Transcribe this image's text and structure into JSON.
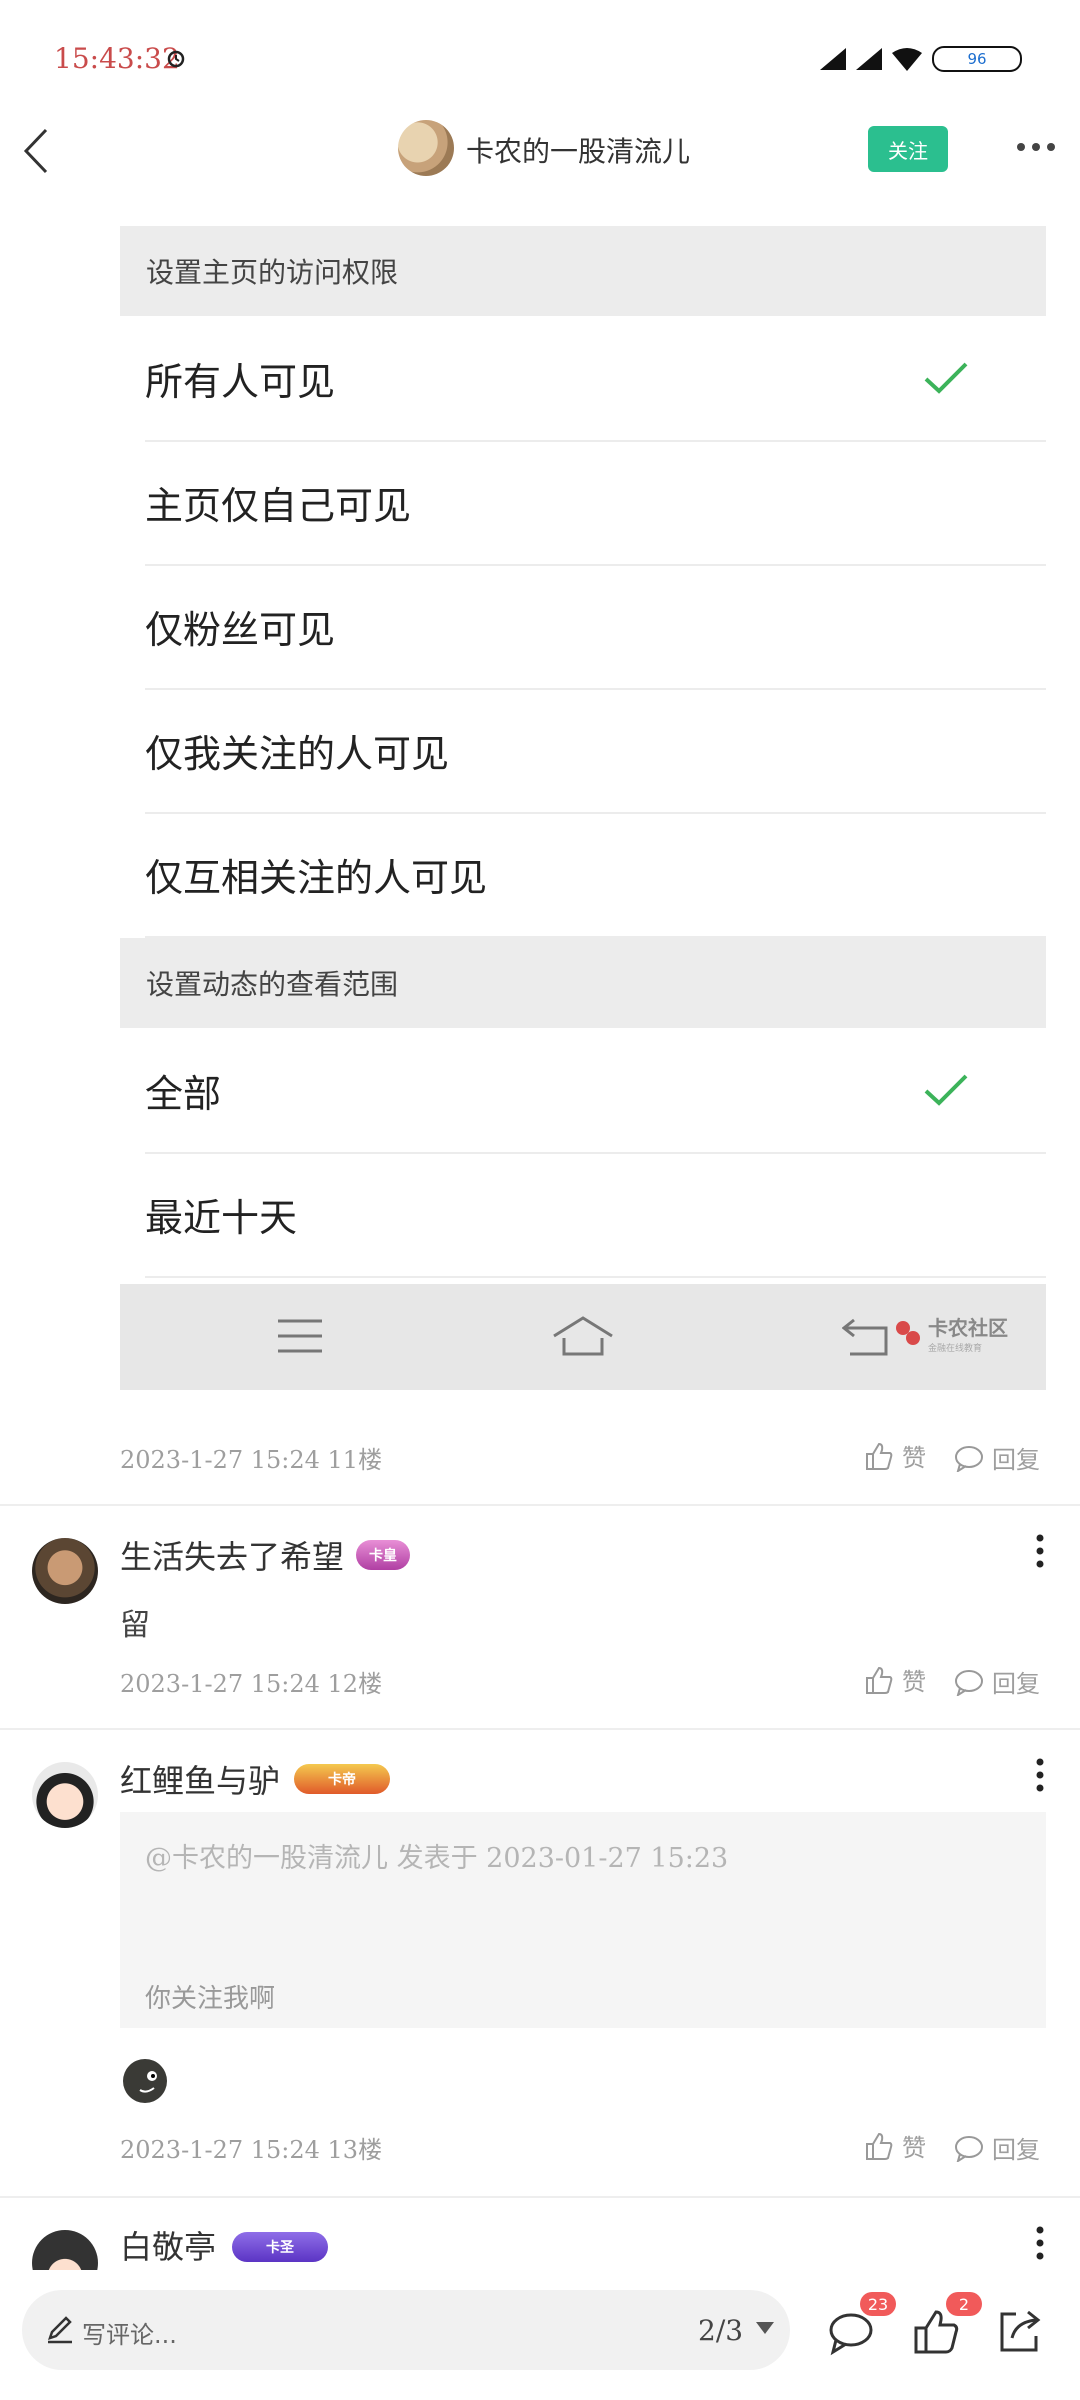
{
  "status_bar": {
    "time": "15:43:32",
    "battery": "96"
  },
  "header": {
    "title": "卡农的一股清流儿",
    "follow_label": "关注"
  },
  "privacy": {
    "homepage_header": "设置主页的访问权限",
    "homepage_options": [
      {
        "label": "所有人可见",
        "checked": true
      },
      {
        "label": "主页仅自己可见",
        "checked": false
      },
      {
        "label": "仅粉丝可见",
        "checked": false
      },
      {
        "label": "仅我关注的人可见",
        "checked": false
      },
      {
        "label": "仅互相关注的人可见",
        "checked": false
      }
    ],
    "feed_header": "设置动态的查看范围",
    "feed_options": [
      {
        "label": "全部",
        "checked": true
      },
      {
        "label": "最近十天",
        "checked": false
      }
    ],
    "brand_name": "卡农社区",
    "brand_sub": "金融在线教育"
  },
  "actions": {
    "like": "赞",
    "reply": "回复"
  },
  "posts": [
    {
      "meta": "2023-1-27 15:24  11楼"
    },
    {
      "author": "生活失去了希望",
      "badge": "卡皇",
      "text": "留",
      "meta": "2023-1-27 15:24  12楼"
    },
    {
      "author": "红鲤鱼与驴",
      "badge": "卡帝",
      "quote_head": "@卡农的一股清流儿 发表于 2023-01-27 15:23",
      "quote_body": "你关注我啊",
      "meta": "2023-1-27 15:24  13楼"
    },
    {
      "author": "白敬亭",
      "badge": "卡圣"
    }
  ],
  "bottom_bar": {
    "placeholder": "写评论...",
    "page": "2/3",
    "comment_count": "23",
    "like_count": "2"
  },
  "colors": {
    "accent": "#2bbf8f",
    "check": "#3cb35a",
    "badge_red": "#f15a5a"
  }
}
